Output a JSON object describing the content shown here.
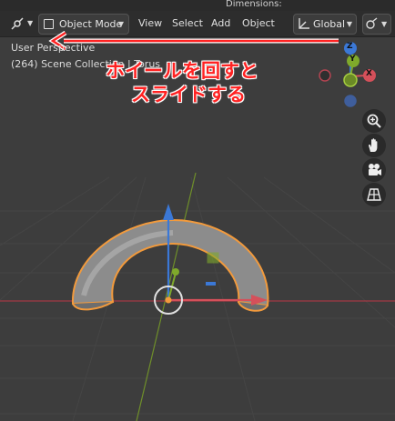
{
  "topbar": {
    "dimensions_label": "Dimensions:"
  },
  "header": {
    "mode_label": "Object Mode",
    "menus": [
      "View",
      "Select",
      "Add",
      "Object"
    ],
    "orientation_label": "Global"
  },
  "viewport": {
    "view_name": "User Perspective",
    "collection_path": "(264) Scene Collection | Torus"
  },
  "annotation": {
    "line1": "ホイールを回すと",
    "line2": "スライドする",
    "color": "#ff2222"
  },
  "gizmo": {
    "z": "Z",
    "y": "Y",
    "x": "X"
  },
  "nav_icons": [
    "zoom-icon",
    "hand-pan-icon",
    "camera-icon",
    "grid-perspective-icon"
  ],
  "colors": {
    "x_axis": "#d5505a",
    "y_axis": "#7fa92b",
    "z_axis": "#3b78d6",
    "selection": "#f29a3c"
  }
}
